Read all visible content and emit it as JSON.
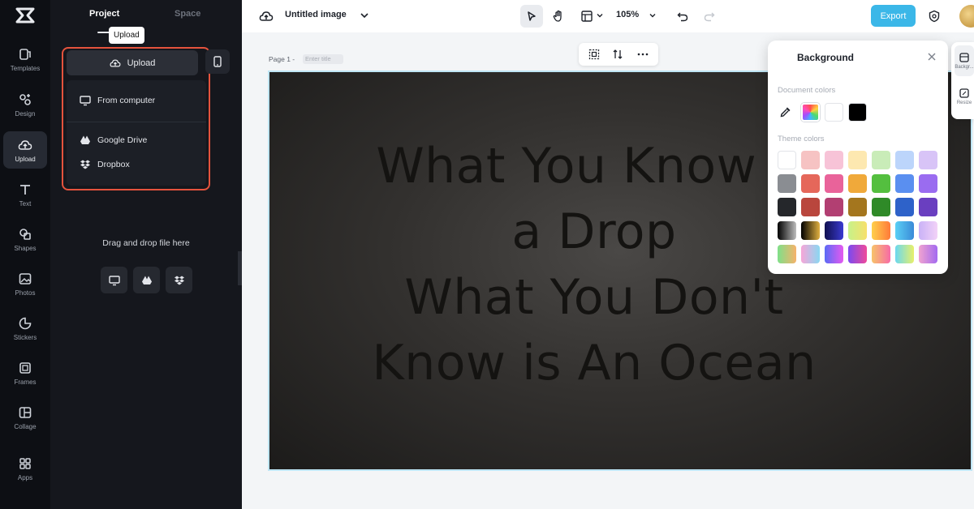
{
  "rail": {
    "items": [
      {
        "label": "Templates",
        "icon": "templates-icon"
      },
      {
        "label": "Design",
        "icon": "design-icon"
      },
      {
        "label": "Upload",
        "icon": "upload-cloud-icon",
        "active": true
      },
      {
        "label": "Text",
        "icon": "text-icon"
      },
      {
        "label": "Shapes",
        "icon": "shapes-icon"
      },
      {
        "label": "Photos",
        "icon": "photos-icon"
      },
      {
        "label": "Stickers",
        "icon": "stickers-icon"
      },
      {
        "label": "Frames",
        "icon": "frames-icon"
      },
      {
        "label": "Collage",
        "icon": "collage-icon"
      },
      {
        "label": "Apps",
        "icon": "apps-icon"
      }
    ]
  },
  "panel": {
    "tabs": {
      "project": "Project",
      "space": "Space"
    },
    "tooltip": "Upload",
    "upload_label": "Upload",
    "menu": {
      "from_computer": "From computer",
      "google_drive": "Google Drive",
      "dropbox": "Dropbox"
    },
    "drag_drop": "Drag and drop file here"
  },
  "topbar": {
    "title": "Untitled image",
    "zoom": "105%",
    "export_label": "Export"
  },
  "canvas": {
    "page_label": "Page 1 -",
    "page_title_placeholder": "Enter title",
    "artboard_text": [
      "What You Know is",
      "a Drop",
      "What You Don't",
      "Know is An Ocean"
    ]
  },
  "background_panel": {
    "title": "Background",
    "document_colors_label": "Document colors",
    "theme_colors_label": "Theme colors",
    "document_colors": [
      "#ffffff",
      "#000000"
    ],
    "theme_colors": [
      [
        "#ffffff",
        "#f6c3c3",
        "#f7c3d7",
        "#fde8b0",
        "#c9ecb8",
        "#bcd5fb",
        "#d8c4f7"
      ],
      [
        "#8a8d92",
        "#e5675a",
        "#e9639a",
        "#f0a93a",
        "#54bf3f",
        "#5a8ff0",
        "#9a6cf0"
      ],
      [
        "#25272b",
        "#b9463d",
        "#b23f72",
        "#a4761e",
        "#2f8a28",
        "#2e62c9",
        "#6a3fc0"
      ]
    ]
  },
  "right_strip": {
    "items": [
      {
        "label": "Backgr..."
      },
      {
        "label": "Resize"
      }
    ]
  },
  "colors": {
    "accent": "#3bb7e8",
    "highlight_border": "#e5533d",
    "rail_bg": "#0d0f14",
    "panel_bg": "#15171d"
  }
}
